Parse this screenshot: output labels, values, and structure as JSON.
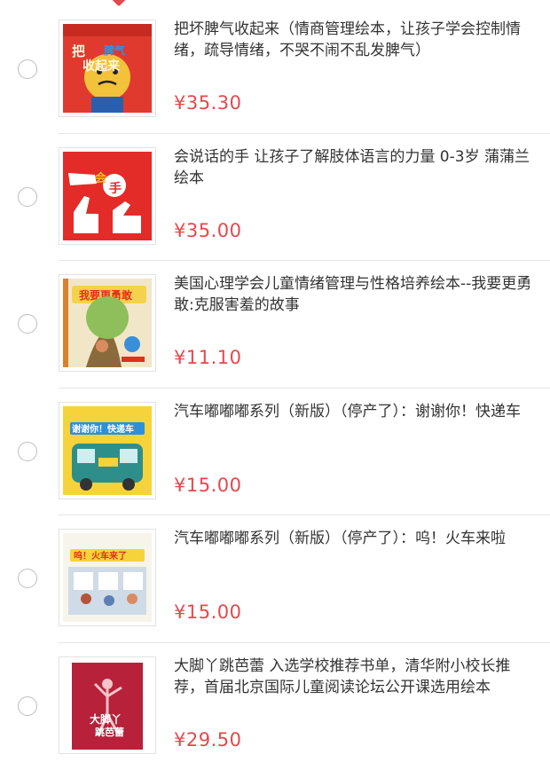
{
  "colors": {
    "price": "#e5484d",
    "title": "#333333",
    "divider": "#e6e6e6",
    "radio_border": "#bdbdbd"
  },
  "items": [
    {
      "title": "把坏脾气收起来（情商管理绘本，让孩子学会控制情绪，疏导情绪，不哭不闹不乱发脾气）",
      "price": "¥35.30",
      "selected": false,
      "cover_icon": "book-cover-icon",
      "cover_text": [
        "把",
        "脾气",
        "收起来"
      ]
    },
    {
      "title": "会说话的手 让孩子了解肢体语言的力量 0-3岁 蒲蒲兰绘本",
      "price": "¥35.00",
      "selected": false,
      "cover_icon": "book-cover-icon",
      "cover_text": [
        "会",
        "手"
      ]
    },
    {
      "title": "美国心理学会儿童情绪管理与性格培养绘本--我要更勇敢:克服害羞的故事",
      "price": "¥11.10",
      "selected": false,
      "cover_icon": "book-cover-icon",
      "cover_text": [
        "我要更勇敢"
      ]
    },
    {
      "title": "汽车嘟嘟嘟系列（新版）（停产了）：谢谢你！快递车",
      "price": "¥15.00",
      "selected": false,
      "cover_icon": "book-cover-icon",
      "cover_text": [
        "谢谢你！快递车"
      ]
    },
    {
      "title": "汽车嘟嘟嘟系列（新版）（停产了）：呜！火车来啦",
      "price": "¥15.00",
      "selected": false,
      "cover_icon": "book-cover-icon",
      "cover_text": [
        "呜！火车来了"
      ]
    },
    {
      "title": "大脚丫跳芭蕾 入选学校推荐书单，清华附小校长推荐，首届北京国际儿童阅读论坛公开课选用绘本",
      "price": "¥29.50",
      "selected": false,
      "cover_icon": "book-cover-icon",
      "cover_text": [
        "大脚丫",
        "跳芭蕾"
      ]
    }
  ]
}
